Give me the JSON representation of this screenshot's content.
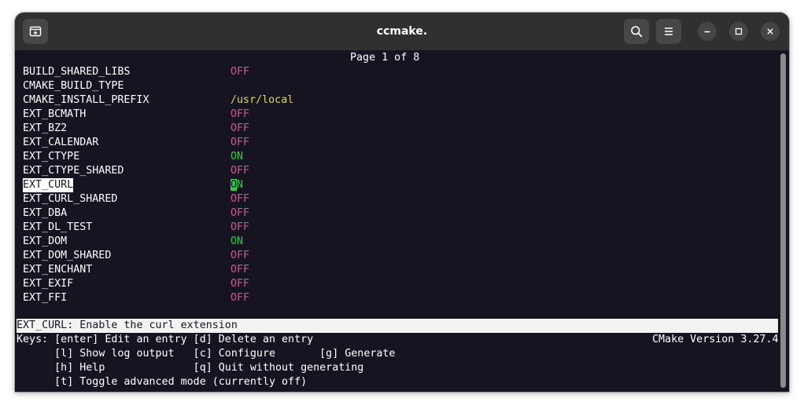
{
  "window": {
    "title": "ccmake."
  },
  "page_indicator": "Page 1 of 8",
  "entries": [
    {
      "name": "BUILD_SHARED_LIBS",
      "value": "OFF"
    },
    {
      "name": "CMAKE_BUILD_TYPE",
      "value": ""
    },
    {
      "name": "CMAKE_INSTALL_PREFIX",
      "value": "/usr/local"
    },
    {
      "name": "EXT_BCMATH",
      "value": "OFF"
    },
    {
      "name": "EXT_BZ2",
      "value": "OFF"
    },
    {
      "name": "EXT_CALENDAR",
      "value": "OFF"
    },
    {
      "name": "EXT_CTYPE",
      "value": "ON"
    },
    {
      "name": "EXT_CTYPE_SHARED",
      "value": "OFF"
    },
    {
      "name": "EXT_CURL",
      "value_cursor": "O",
      "value_rest": "N"
    },
    {
      "name": "EXT_CURL_SHARED",
      "value": "OFF"
    },
    {
      "name": "EXT_DBA",
      "value": "OFF"
    },
    {
      "name": "EXT_DL_TEST",
      "value": "OFF"
    },
    {
      "name": "EXT_DOM",
      "value": "ON"
    },
    {
      "name": "EXT_DOM_SHARED",
      "value": "OFF"
    },
    {
      "name": "EXT_ENCHANT",
      "value": "OFF"
    },
    {
      "name": "EXT_EXIF",
      "value": "OFF"
    },
    {
      "name": "EXT_FFI",
      "value": "OFF"
    }
  ],
  "status": "EXT_CURL: Enable the curl extension",
  "keys": {
    "line1": "Keys: [enter] Edit an entry [d] Delete an entry",
    "version": "CMake Version 3.27.4",
    "line2": "      [l] Show log output   [c] Configure       [g] Generate",
    "line3": "      [h] Help              [q] Quit without generating",
    "line4": "      [t] Toggle advanced mode (currently off)"
  },
  "colors": {
    "terminal_bg": "#171421",
    "off": "#d1559b",
    "on": "#33c94a",
    "path": "#d7d76a",
    "titlebar": "#303030"
  },
  "icons": {
    "new_tab": "new-tab-icon",
    "search": "search-icon",
    "menu": "hamburger-menu-icon",
    "minimize": "minimize-icon",
    "maximize": "maximize-icon",
    "close": "close-icon"
  }
}
